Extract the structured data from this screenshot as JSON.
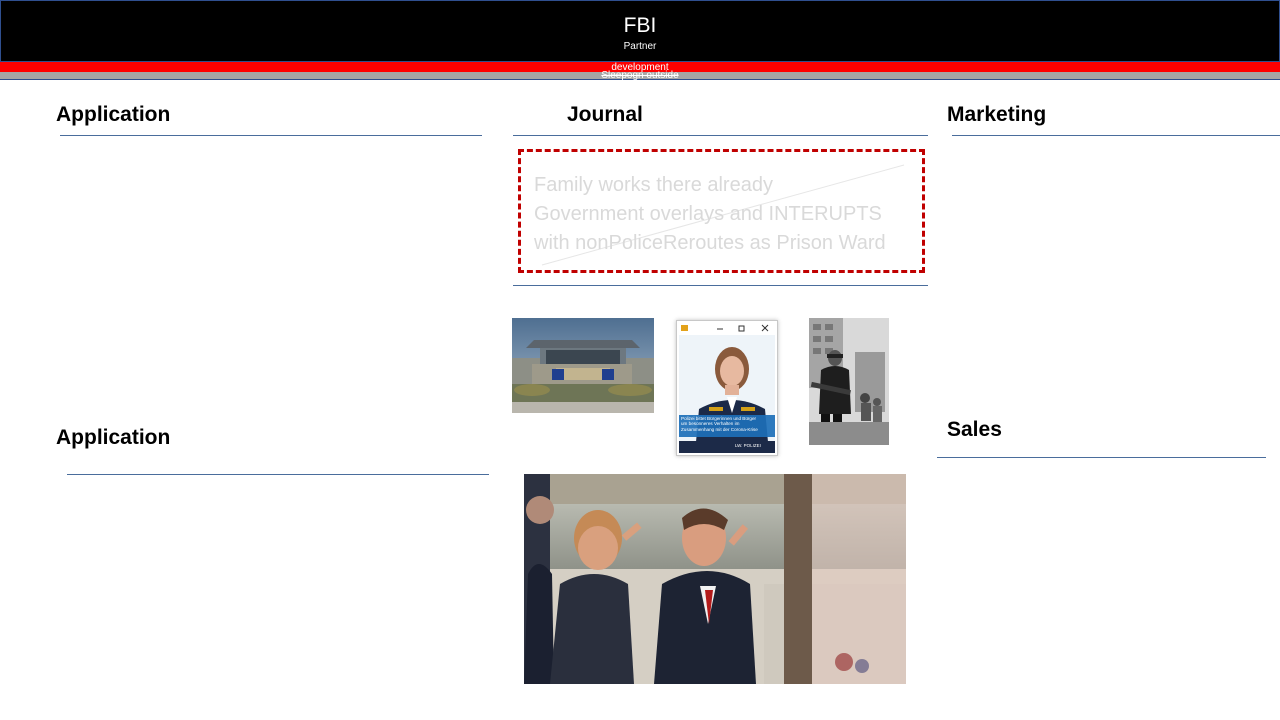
{
  "header": {
    "title": "FBI",
    "subtitle": "Partner",
    "red_strip_label": "development",
    "gray_strip_label": "Sleepogn outside"
  },
  "sections": {
    "application_top": "Application",
    "journal": "Journal",
    "marketing": "Marketing",
    "application_bottom": "Application",
    "sales": "Sales"
  },
  "note": {
    "lines": [
      "Family works there already",
      "Government overlays and INTERUPTS",
      "with nonPoliceReroutes as Prison Ward"
    ]
  },
  "police_card": {
    "caption_lines": [
      "Polizei bittet Bürgerinnen und Bürger",
      "um besonneres Verhalten im",
      "Zusammenhang mit der Corona-Krise"
    ],
    "footer": "LW. POLIZEI"
  },
  "colors": {
    "header_bg": "#000000",
    "strip_red": "#ff0000",
    "strip_gray": "#a6a6a6",
    "rule": "#4a6d9c",
    "note_border": "#c00000",
    "note_text": "#d9d9d9"
  }
}
